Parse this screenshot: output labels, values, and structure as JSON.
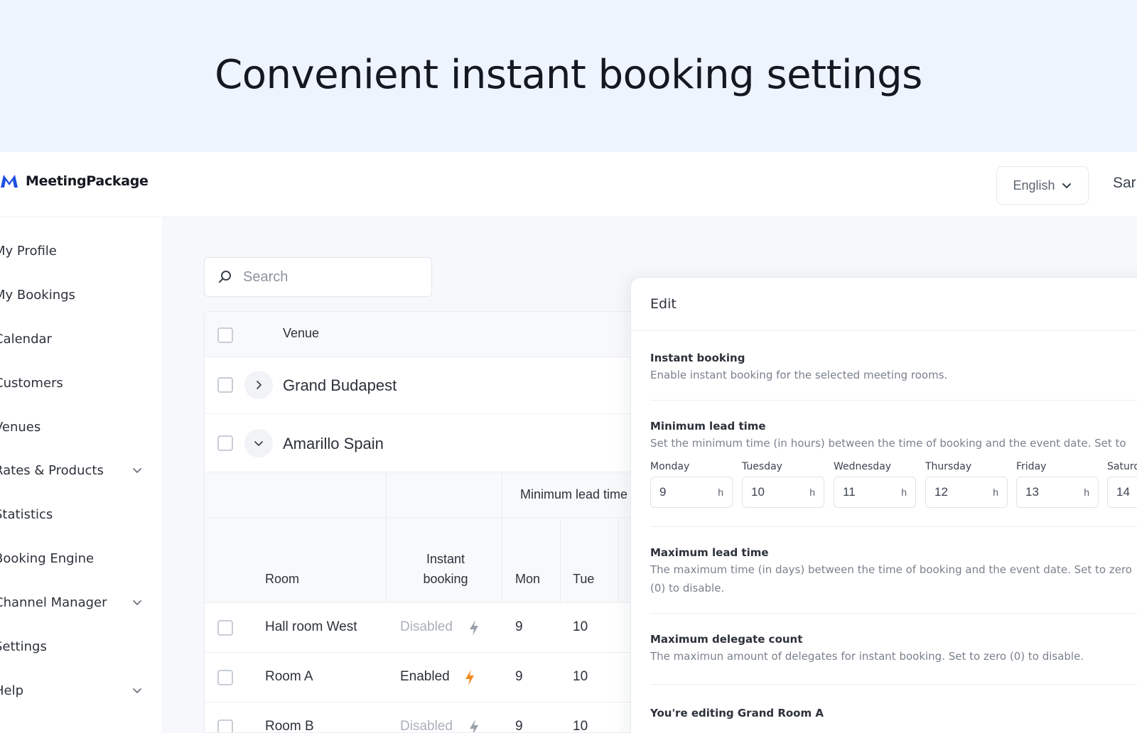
{
  "hero": {
    "title": "Convenient instant booking settings"
  },
  "app": {
    "brand": "MeetingPackage",
    "language": "English",
    "user_name_partial": "Sar",
    "brand_color": "#1f4fe0",
    "accent_bolt_color": "#f28a1c"
  },
  "sidebar": {
    "items": [
      {
        "label": "My Profile",
        "has_chevron": false
      },
      {
        "label": "My Bookings",
        "has_chevron": false
      },
      {
        "label": "Calendar",
        "has_chevron": false
      },
      {
        "label": "Customers",
        "has_chevron": false
      },
      {
        "label": "Venues",
        "has_chevron": false
      },
      {
        "label": "Rates & Products",
        "has_chevron": true
      },
      {
        "label": "Statistics",
        "has_chevron": false
      },
      {
        "label": "Booking Engine",
        "has_chevron": false
      },
      {
        "label": "Channel Manager",
        "has_chevron": true
      },
      {
        "label": "Settings",
        "has_chevron": false
      },
      {
        "label": "Help",
        "has_chevron": true
      }
    ]
  },
  "search": {
    "placeholder": "Search"
  },
  "table": {
    "header_venue": "Venue",
    "venues": [
      {
        "name": "Grand Budapest",
        "expanded": false
      },
      {
        "name": "Amarillo Spain",
        "expanded": true
      }
    ],
    "group_header": "Minimum lead time",
    "columns": {
      "room": "Room",
      "instant_booking_1": "Instant",
      "instant_booking_2": "booking",
      "mon": "Mon",
      "tue": "Tue"
    },
    "rows": [
      {
        "room": "Hall room West",
        "status": "Disabled",
        "enabled": false,
        "mon": "9",
        "tue": "10"
      },
      {
        "room": "Room A",
        "status": "Enabled",
        "enabled": true,
        "mon": "9",
        "tue": "10"
      },
      {
        "room": "Room B",
        "status": "Disabled",
        "enabled": false,
        "mon": "9",
        "tue": "10"
      }
    ]
  },
  "edit_panel": {
    "title": "Edit",
    "instant_booking": {
      "title": "Instant booking",
      "description": "Enable instant booking for the selected meeting rooms."
    },
    "minimum_lead_time": {
      "title": "Minimum lead time",
      "description": "Set the minimum time (in hours) between the time of booking and the event date. Set to",
      "unit": "h",
      "days": [
        {
          "label": "Monday",
          "value": "9"
        },
        {
          "label": "Tuesday",
          "value": "10"
        },
        {
          "label": "Wednesday",
          "value": "11"
        },
        {
          "label": "Thursday",
          "value": "12"
        },
        {
          "label": "Friday",
          "value": "13"
        },
        {
          "label": "Saturday",
          "value": "14"
        }
      ]
    },
    "maximum_lead_time": {
      "title": "Maximum lead time",
      "description": "The maximum time (in days) between the time of booking and the event date. Set to zero (0) to disable."
    },
    "maximum_delegate_count": {
      "title": "Maximum delegate count",
      "description": "The maximun amount of delegates for instant booking. Set to zero (0) to disable."
    },
    "editing_note": "You're editing Grand Room A"
  }
}
